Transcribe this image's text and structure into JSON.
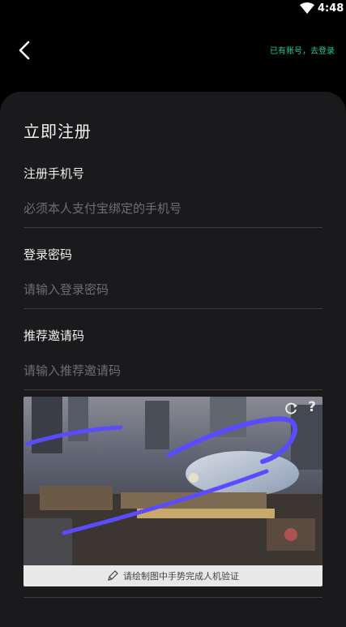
{
  "status_bar": {
    "time": "4:48"
  },
  "header": {
    "login_link": "已有账号，去登录"
  },
  "form": {
    "title": "立即注册",
    "phone": {
      "label": "注册手机号",
      "placeholder": "必须本人支付宝绑定的手机号",
      "value": ""
    },
    "password": {
      "label": "登录密码",
      "placeholder": "请输入登录密码",
      "value": ""
    },
    "invite": {
      "label": "推荐邀请码",
      "placeholder": "请输入推荐邀请码",
      "value": ""
    }
  },
  "captcha": {
    "hint": "请绘制图中手势完成人机验证",
    "help_label": "?",
    "gesture_color": "#5a4bff"
  },
  "icons": {
    "back": "chevron-left-icon",
    "wifi": "wifi-icon",
    "refresh": "refresh-icon",
    "pencil": "pencil-icon"
  }
}
